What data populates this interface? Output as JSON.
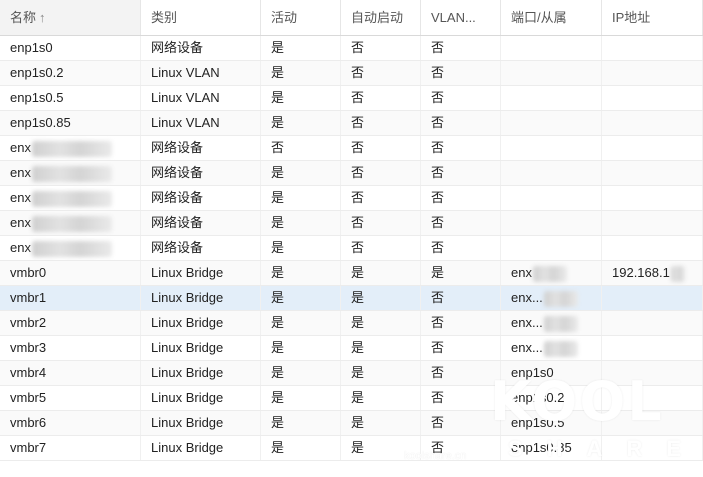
{
  "columns": [
    {
      "label": "名称",
      "sort": "↑"
    },
    {
      "label": "类别"
    },
    {
      "label": "活动"
    },
    {
      "label": "自动启动"
    },
    {
      "label": "VLAN..."
    },
    {
      "label": "端口/从属"
    },
    {
      "label": "IP地址"
    }
  ],
  "rows": [
    {
      "name": "enp1s0",
      "type": "网络设备",
      "active": "是",
      "autostart": "否",
      "vlan": "否",
      "ports": "",
      "ip": ""
    },
    {
      "name": "enp1s0.2",
      "type": "Linux VLAN",
      "active": "是",
      "autostart": "否",
      "vlan": "否",
      "ports": "",
      "ip": ""
    },
    {
      "name": "enp1s0.5",
      "type": "Linux VLAN",
      "active": "是",
      "autostart": "否",
      "vlan": "否",
      "ports": "",
      "ip": ""
    },
    {
      "name": "enp1s0.85",
      "type": "Linux VLAN",
      "active": "是",
      "autostart": "否",
      "vlan": "否",
      "ports": "",
      "ip": ""
    },
    {
      "name": "enx",
      "type": "网络设备",
      "active": "否",
      "autostart": "否",
      "vlan": "否",
      "ports": "",
      "ip": ""
    },
    {
      "name": "enx",
      "type": "网络设备",
      "active": "是",
      "autostart": "否",
      "vlan": "否",
      "ports": "",
      "ip": ""
    },
    {
      "name": "enx",
      "type": "网络设备",
      "active": "是",
      "autostart": "否",
      "vlan": "否",
      "ports": "",
      "ip": ""
    },
    {
      "name": "enx",
      "type": "网络设备",
      "active": "是",
      "autostart": "否",
      "vlan": "否",
      "ports": "",
      "ip": ""
    },
    {
      "name": "enx",
      "type": "网络设备",
      "active": "是",
      "autostart": "否",
      "vlan": "否",
      "ports": "",
      "ip": ""
    },
    {
      "name": "vmbr0",
      "type": "Linux Bridge",
      "active": "是",
      "autostart": "是",
      "vlan": "是",
      "ports": "enx",
      "ip": "192.168.1"
    },
    {
      "name": "vmbr1",
      "type": "Linux Bridge",
      "active": "是",
      "autostart": "是",
      "vlan": "否",
      "ports": "enx...",
      "ip": ""
    },
    {
      "name": "vmbr2",
      "type": "Linux Bridge",
      "active": "是",
      "autostart": "是",
      "vlan": "否",
      "ports": "enx...",
      "ip": ""
    },
    {
      "name": "vmbr3",
      "type": "Linux Bridge",
      "active": "是",
      "autostart": "是",
      "vlan": "否",
      "ports": "enx...",
      "ip": ""
    },
    {
      "name": "vmbr4",
      "type": "Linux Bridge",
      "active": "是",
      "autostart": "是",
      "vlan": "否",
      "ports": "enp1s0",
      "ip": ""
    },
    {
      "name": "vmbr5",
      "type": "Linux Bridge",
      "active": "是",
      "autostart": "是",
      "vlan": "否",
      "ports": "enp1s0.2",
      "ip": ""
    },
    {
      "name": "vmbr6",
      "type": "Linux Bridge",
      "active": "是",
      "autostart": "是",
      "vlan": "否",
      "ports": "enp1s0.5",
      "ip": ""
    },
    {
      "name": "vmbr7",
      "type": "Linux Bridge",
      "active": "是",
      "autostart": "是",
      "vlan": "否",
      "ports": "enp1s0.85",
      "ip": ""
    }
  ],
  "selected_row": 10,
  "watermark": {
    "logo": "KOOL",
    "sub": "SHARE",
    "url": "koolshare.cn"
  }
}
